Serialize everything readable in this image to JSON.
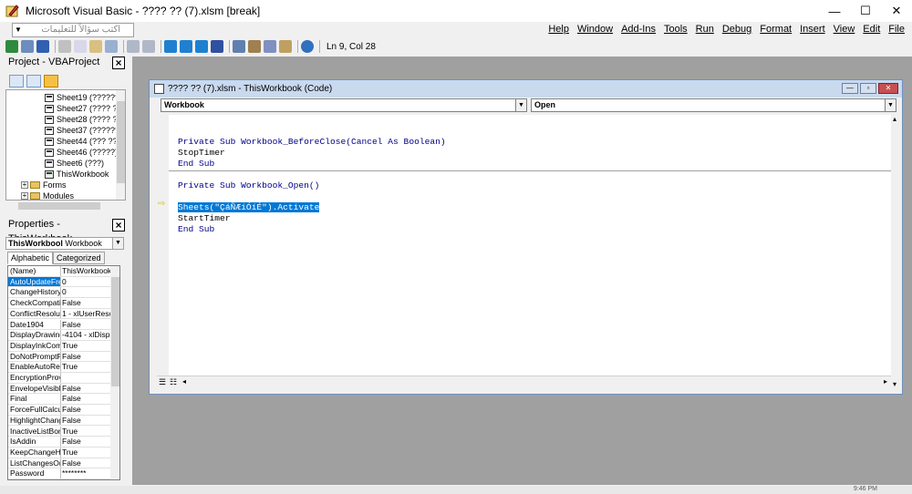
{
  "window": {
    "title": "Microsoft Visual Basic - ???? ?? (7).xlsm [break]",
    "minimize": "—",
    "maximize": "☐",
    "close": "✕"
  },
  "ask": {
    "placeholder": "اكتب سؤالاً للتعليمات"
  },
  "menus": [
    "Help",
    "Window",
    "Add-Ins",
    "Tools",
    "Run",
    "Debug",
    "Format",
    "Insert",
    "View",
    "Edit",
    "File"
  ],
  "toolbar": {
    "position": "Ln 9, Col 28"
  },
  "project": {
    "title": "Project - VBAProject",
    "items": [
      "Sheet19 (??????",
      "Sheet27 (???? ??",
      "Sheet28 (???? ??",
      "Sheet37 (??????",
      "Sheet44 (??? ???",
      "Sheet46 (?????)",
      "Sheet6 (???)",
      "ThisWorkbook"
    ],
    "folders": [
      "Forms",
      "Modules"
    ]
  },
  "properties": {
    "title": "Properties - ThisWorkbook",
    "object_name": "ThisWorkbool",
    "object_type": "Workbook",
    "tabs": [
      "Alphabetic",
      "Categorized"
    ],
    "rows": [
      [
        "(Name)",
        "ThisWorkbook"
      ],
      [
        "AutoUpdateFre",
        "0"
      ],
      [
        "ChangeHistoryD",
        "0"
      ],
      [
        "CheckCompatibi",
        "False"
      ],
      [
        "ConflictResolutx",
        "1 - xlUserReso"
      ],
      [
        "Date1904",
        "False"
      ],
      [
        "DisplayDrawingC",
        "-4104 - xlDispl"
      ],
      [
        "DisplayInkComm",
        "True"
      ],
      [
        "DoNotPromptFo",
        "False"
      ],
      [
        "EnableAutoReco",
        "True"
      ],
      [
        "EncryptionProvi",
        ""
      ],
      [
        "EnvelopeVisible",
        "False"
      ],
      [
        "Final",
        "False"
      ],
      [
        "ForceFullCalcula",
        "False"
      ],
      [
        "HighlightChange",
        "False"
      ],
      [
        "InactiveListBord",
        "True"
      ],
      [
        "IsAddin",
        "False"
      ],
      [
        "KeepChangeHis",
        "True"
      ],
      [
        "ListChangesOnN",
        "False"
      ],
      [
        "Password",
        "********"
      ]
    ]
  },
  "code_window": {
    "title": "???? ?? (7).xlsm - ThisWorkbook (Code)",
    "object_combo": "Workbook",
    "proc_combo": "Open",
    "lines": [
      "Private Sub Workbook_BeforeClose(Cancel As Boolean)",
      "StopTimer",
      "End Sub",
      "Private Sub Workbook_Open()",
      "Sheets(\"ÇáÑÆíÓíÉ\").Activate",
      "StartTimer",
      "End Sub"
    ]
  },
  "taskbar": {
    "clock": "9:46 PM"
  },
  "colors": {
    "selection": "#0078d7",
    "keyword": "#00008b",
    "mdi_background": "#a0a0a0",
    "exec_arrow": "#e5c000"
  }
}
